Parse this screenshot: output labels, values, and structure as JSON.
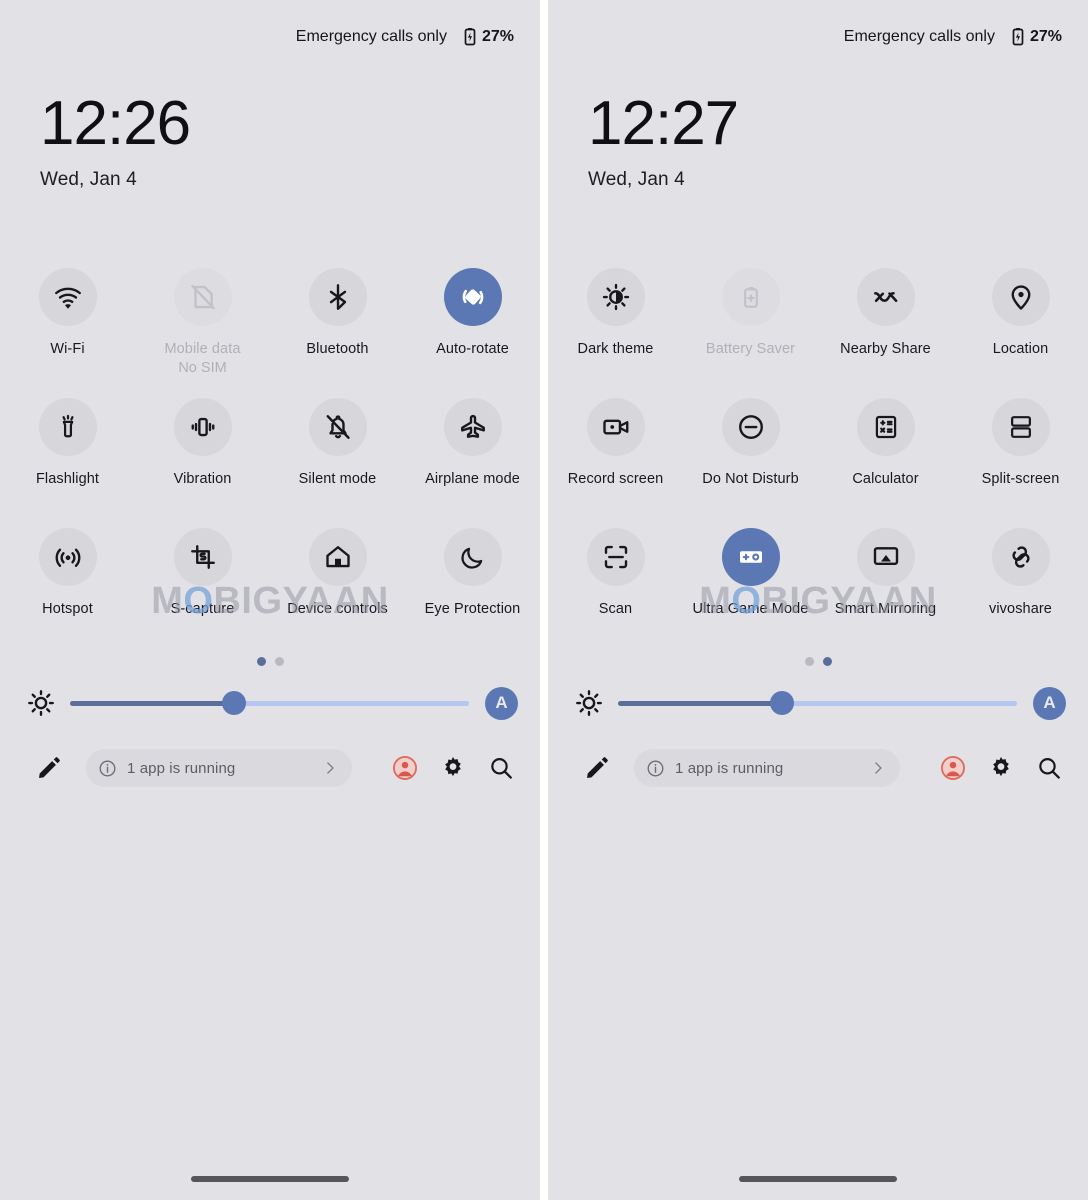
{
  "watermark": {
    "part1": "M",
    "part2": "O",
    "part3": "BIGYAAN"
  },
  "colors": {
    "background": "#e2e2e6",
    "tile_bubble": "#d6d6db",
    "tile_active": "#5b78b5",
    "slider_fill": "#5b6e9b",
    "slider_track": "#b4c6ef",
    "disabled_text": "#b0b0b7",
    "avatar_red": "#e06a5e",
    "home_indicator": "#55555a"
  },
  "panels": [
    {
      "id": "quick-settings-page-1",
      "status": {
        "carrier": "Emergency calls only",
        "battery_icon": "battery-charging-icon",
        "battery_percent": "27%"
      },
      "clock": {
        "time": "12:26",
        "date": "Wed, Jan 4"
      },
      "tiles": [
        {
          "label": "Wi-Fi",
          "sublabel": "",
          "icon": "wifi-icon",
          "state": "default"
        },
        {
          "label": "Mobile data",
          "sublabel": "No SIM",
          "icon": "sim-off-icon",
          "state": "disabled"
        },
        {
          "label": "Bluetooth",
          "sublabel": "",
          "icon": "bluetooth-icon",
          "state": "default"
        },
        {
          "label": "Auto-rotate",
          "sublabel": "",
          "icon": "auto-rotate-icon",
          "state": "active"
        },
        {
          "label": "Flashlight",
          "sublabel": "",
          "icon": "flashlight-icon",
          "state": "default"
        },
        {
          "label": "Vibration",
          "sublabel": "",
          "icon": "vibration-icon",
          "state": "default"
        },
        {
          "label": "Silent mode",
          "sublabel": "",
          "icon": "bell-off-icon",
          "state": "default"
        },
        {
          "label": "Airplane mode",
          "sublabel": "",
          "icon": "airplane-icon",
          "state": "default"
        },
        {
          "label": "Hotspot",
          "sublabel": "",
          "icon": "hotspot-icon",
          "state": "default"
        },
        {
          "label": "S-capture",
          "sublabel": "",
          "icon": "screen-capture-icon",
          "state": "default"
        },
        {
          "label": "Device controls",
          "sublabel": "",
          "icon": "home-icon",
          "state": "default"
        },
        {
          "label": "Eye Protection",
          "sublabel": "",
          "icon": "moon-icon",
          "state": "default"
        }
      ],
      "pager": {
        "count": 2,
        "active_index": 0
      },
      "brightness": {
        "icon": "brightness-sun-icon",
        "value_percent": 41,
        "auto_label": "A"
      },
      "footer": {
        "edit_icon": "pencil-icon",
        "running_info_icon": "info-circle-icon",
        "running_text": "1 app is running",
        "running_chevron_icon": "chevron-right-icon",
        "user_icon": "user-circle-icon",
        "settings_icon": "gear-icon",
        "search_icon": "search-icon"
      }
    },
    {
      "id": "quick-settings-page-2",
      "status": {
        "carrier": "Emergency calls only",
        "battery_icon": "battery-charging-icon",
        "battery_percent": "27%"
      },
      "clock": {
        "time": "12:27",
        "date": "Wed, Jan 4"
      },
      "tiles": [
        {
          "label": "Dark theme",
          "sublabel": "",
          "icon": "dark-theme-icon",
          "state": "default"
        },
        {
          "label": "Battery Saver",
          "sublabel": "",
          "icon": "battery-saver-icon",
          "state": "disabled"
        },
        {
          "label": "Nearby Share",
          "sublabel": "",
          "icon": "nearby-share-icon",
          "state": "default"
        },
        {
          "label": "Location",
          "sublabel": "",
          "icon": "location-pin-icon",
          "state": "default"
        },
        {
          "label": "Record screen",
          "sublabel": "",
          "icon": "video-camera-icon",
          "state": "default"
        },
        {
          "label": "Do Not Disturb",
          "sublabel": "",
          "icon": "minus-circle-icon",
          "state": "default"
        },
        {
          "label": "Calculator",
          "sublabel": "",
          "icon": "calculator-icon",
          "state": "default"
        },
        {
          "label": "Split-screen",
          "sublabel": "",
          "icon": "split-screen-icon",
          "state": "default"
        },
        {
          "label": "Scan",
          "sublabel": "",
          "icon": "scan-frame-icon",
          "state": "default"
        },
        {
          "label": "Ultra Game Mode",
          "sublabel": "",
          "icon": "gamepad-icon",
          "state": "active"
        },
        {
          "label": "Smart Mirroring",
          "sublabel": "",
          "icon": "cast-screen-icon",
          "state": "default"
        },
        {
          "label": "vivoshare",
          "sublabel": "",
          "icon": "link-chain-icon",
          "state": "default"
        }
      ],
      "pager": {
        "count": 2,
        "active_index": 1
      },
      "brightness": {
        "icon": "brightness-sun-icon",
        "value_percent": 41,
        "auto_label": "A"
      },
      "footer": {
        "edit_icon": "pencil-icon",
        "running_info_icon": "info-circle-icon",
        "running_text": "1 app is running",
        "running_chevron_icon": "chevron-right-icon",
        "user_icon": "user-circle-icon",
        "settings_icon": "gear-icon",
        "search_icon": "search-icon"
      }
    }
  ]
}
